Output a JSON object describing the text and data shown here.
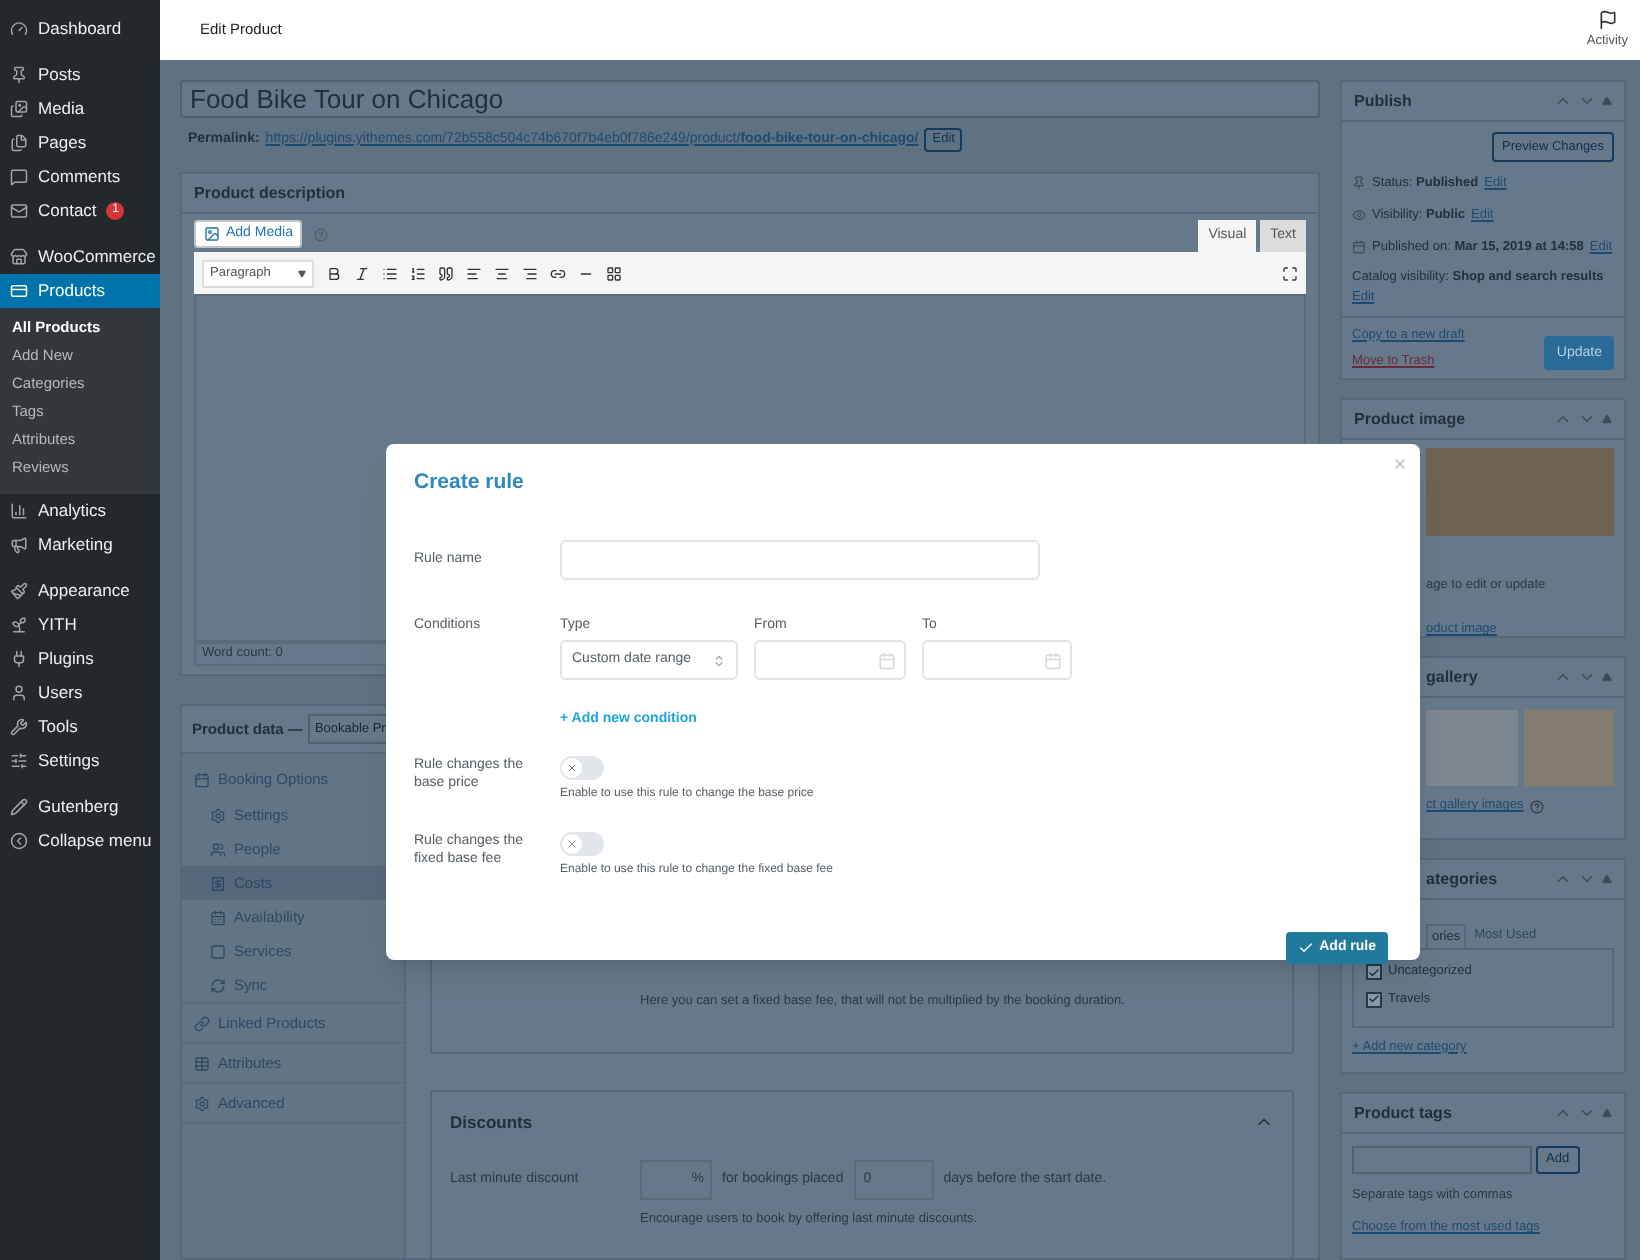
{
  "sidebar": {
    "groups": [
      [
        {
          "label": "Dashboard",
          "selected": false
        }
      ],
      [
        {
          "label": "Posts",
          "selected": false
        },
        {
          "label": "Media",
          "selected": false
        },
        {
          "label": "Pages",
          "selected": false
        },
        {
          "label": "Comments",
          "selected": false
        },
        {
          "label": "Contact",
          "selected": false,
          "badge": "1"
        }
      ],
      [
        {
          "label": "WooCommerce",
          "selected": false
        },
        {
          "label": "Products",
          "selected": true,
          "children": [
            {
              "label": "All Products",
              "selected": true
            },
            {
              "label": "Add New",
              "selected": false
            },
            {
              "label": "Categories",
              "selected": false
            },
            {
              "label": "Tags",
              "selected": false
            },
            {
              "label": "Attributes",
              "selected": false
            },
            {
              "label": "Reviews",
              "selected": false
            }
          ]
        },
        {
          "label": "Analytics",
          "selected": false
        },
        {
          "label": "Marketing",
          "selected": false
        }
      ],
      [
        {
          "label": "Appearance",
          "selected": false
        },
        {
          "label": "YITH",
          "selected": false
        },
        {
          "label": "Plugins",
          "selected": false
        },
        {
          "label": "Users",
          "selected": false
        },
        {
          "label": "Tools",
          "selected": false
        },
        {
          "label": "Settings",
          "selected": false
        }
      ],
      [
        {
          "label": "Gutenberg",
          "selected": false
        },
        {
          "label": "Collapse menu",
          "selected": false
        }
      ]
    ]
  },
  "top_bar": {
    "title": "Edit Product",
    "activity": "Activity"
  },
  "product": {
    "title": "Food Bike Tour on Chicago",
    "permalink": {
      "label": "Permalink:",
      "url": "https://plugins.yithemes.com/72b558c504c74b670f7b4eb0f786e249/product/**food-bike-tour-on-chicago/**",
      "edit": "Edit"
    }
  },
  "description": {
    "title": "Product description",
    "add_media": "Add Media",
    "tabs": [
      {
        "label": "Visual",
        "selected": true
      },
      {
        "label": "Text",
        "selected": false
      }
    ],
    "format": "Paragraph",
    "word_count": "Word count: 0"
  },
  "product_data": {
    "label": "Product data —",
    "type": "Bookable Pr",
    "tabs": [
      {
        "label": "Booking Options",
        "selected": false,
        "children": [
          {
            "label": "Settings",
            "selected": false
          },
          {
            "label": "People",
            "selected": false
          },
          {
            "label": "Costs",
            "selected": true
          },
          {
            "label": "Availability",
            "selected": false
          },
          {
            "label": "Services",
            "selected": false
          },
          {
            "label": "Sync",
            "selected": false
          }
        ]
      },
      {
        "label": "Linked Products",
        "selected": false
      },
      {
        "label": "Attributes",
        "selected": false
      },
      {
        "label": "Advanced",
        "selected": false
      }
    ],
    "fixed_fee_help": "Here you can set a fixed base fee, that will not be multiplied by the booking duration.",
    "discounts": {
      "title": "Discounts",
      "expanded": true,
      "label": "Last minute discount",
      "unit": "%",
      "middle": "for bookings placed",
      "days": "0",
      "suffix": "days before the start date.",
      "help": "Encourage users to book by offering last minute discounts."
    }
  },
  "publish": {
    "title": "Publish",
    "preview": "Preview Changes",
    "rows": [
      {
        "label": "Status:",
        "value": "Published",
        "edit": "Edit"
      },
      {
        "label": "Visibility:",
        "value": "Public",
        "edit": "Edit"
      },
      {
        "label": "Published on:",
        "value": "Mar 15, 2019 at 14:58",
        "edit": "Edit"
      }
    ],
    "catalog": {
      "label": "Catalog visibility:",
      "value": "Shop and search results",
      "edit": "Edit"
    },
    "copy": "Copy to a new draft",
    "trash": "Move to Trash",
    "update": "Update"
  },
  "product_image": {
    "title": "Product image",
    "hint": "age to edit or update",
    "link": "oduct image"
  },
  "gallery": {
    "title": "gallery",
    "link": "ct gallery images"
  },
  "categories": {
    "title": "ategories",
    "tabs": [
      {
        "label": "ories",
        "selected": true
      },
      {
        "label": "Most Used",
        "selected": false
      }
    ],
    "items": [
      {
        "label": "Uncategorized",
        "checked": true
      },
      {
        "label": "Travels",
        "checked": true
      }
    ],
    "add": "+ Add new category"
  },
  "tags": {
    "title": "Product tags",
    "add": "Add",
    "hint": "Separate tags with commas",
    "link": "Choose from the most used tags"
  },
  "modal": {
    "title": "Create rule",
    "rule_name_label": "Rule name",
    "conditions_label": "Conditions",
    "condition": {
      "type_label": "Type",
      "type": "Custom date range",
      "from_label": "From",
      "to_label": "To"
    },
    "add_condition": "+ Add new condition",
    "switches": [
      {
        "label": "Rule changes the base price",
        "on": false,
        "help": "Enable to use this rule to change the base price"
      },
      {
        "label": "Rule changes the fixed base fee",
        "on": false,
        "help": "Enable to use this rule to change the fixed base fee"
      }
    ],
    "submit": "Add rule"
  }
}
